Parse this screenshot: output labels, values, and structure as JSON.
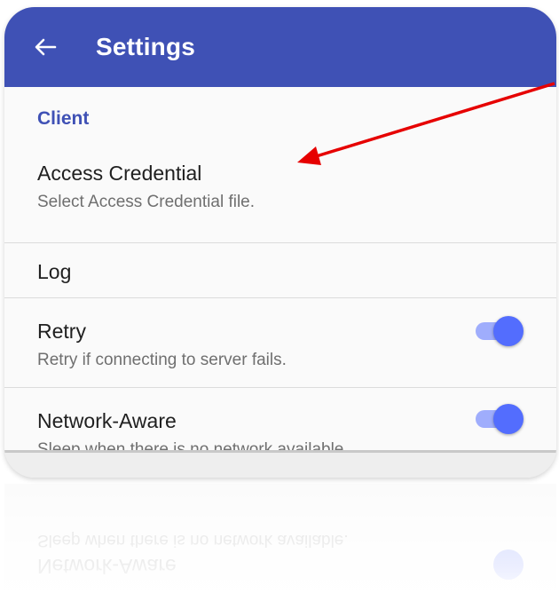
{
  "colors": {
    "primary": "#3f51b5",
    "category_text": "#3f51b5",
    "accent": "#536dfe",
    "track": "#8c9eff",
    "annotation_arrow": "#e60000"
  },
  "appbar": {
    "back_icon": "arrow-left-icon",
    "title": "Settings"
  },
  "category": {
    "title": "Client"
  },
  "items": [
    {
      "title": "Access Credential",
      "summary": "Select Access Credential file."
    },
    {
      "title": "Log"
    },
    {
      "title": "Retry",
      "summary": "Retry if connecting to server fails.",
      "toggle_on": true
    },
    {
      "title": "Network-Aware",
      "summary": "Sleep when there is no network available.",
      "toggle_on": true
    }
  ]
}
